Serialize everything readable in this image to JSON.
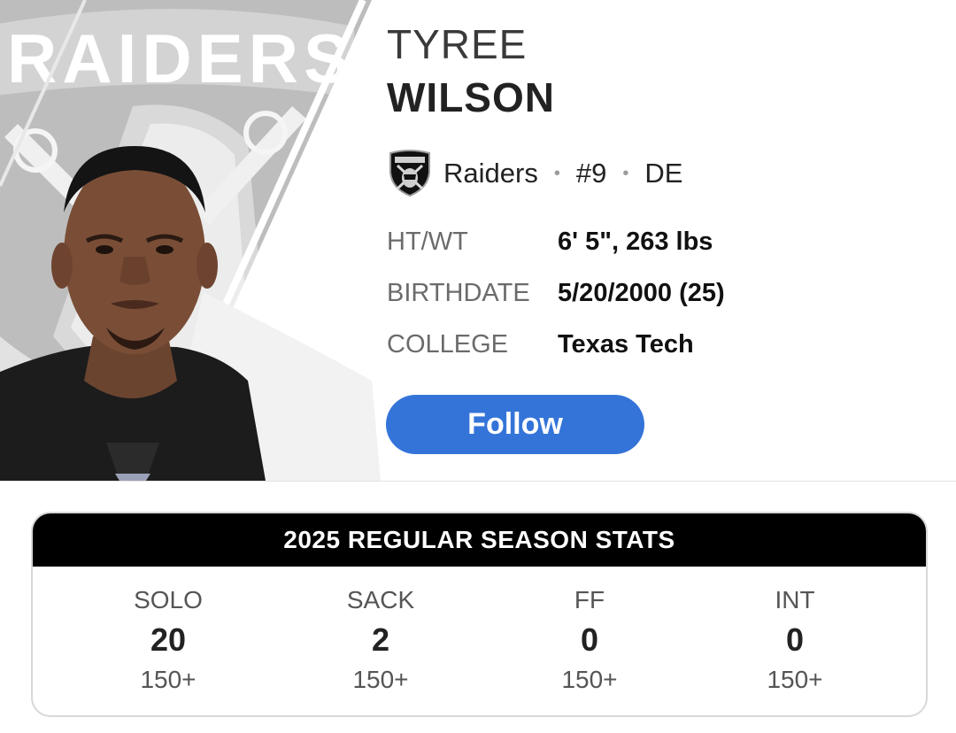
{
  "player": {
    "first_name": "TYREE",
    "last_name": "WILSON",
    "team": "Raiders",
    "number": "#9",
    "position": "DE",
    "separator": "•",
    "team_logo_icon": "raiders-shield-icon"
  },
  "bio": [
    {
      "label": "HT/WT",
      "value": "6' 5\", 263 lbs"
    },
    {
      "label": "BIRTHDATE",
      "value": "5/20/2000 (25)"
    },
    {
      "label": "COLLEGE",
      "value": "Texas Tech"
    }
  ],
  "follow_label": "Follow",
  "hero_background_text": "RAIDERS",
  "stats": {
    "title": "2025 REGULAR SEASON STATS",
    "items": [
      {
        "label": "SOLO",
        "value": "20",
        "rank": "150+"
      },
      {
        "label": "SACK",
        "value": "2",
        "rank": "150+"
      },
      {
        "label": "FF",
        "value": "0",
        "rank": "150+"
      },
      {
        "label": "INT",
        "value": "0",
        "rank": "150+"
      }
    ]
  },
  "colors": {
    "accent": "#3474d8",
    "header_bg": "#000000",
    "hero_gray": "#b9b9b9"
  }
}
